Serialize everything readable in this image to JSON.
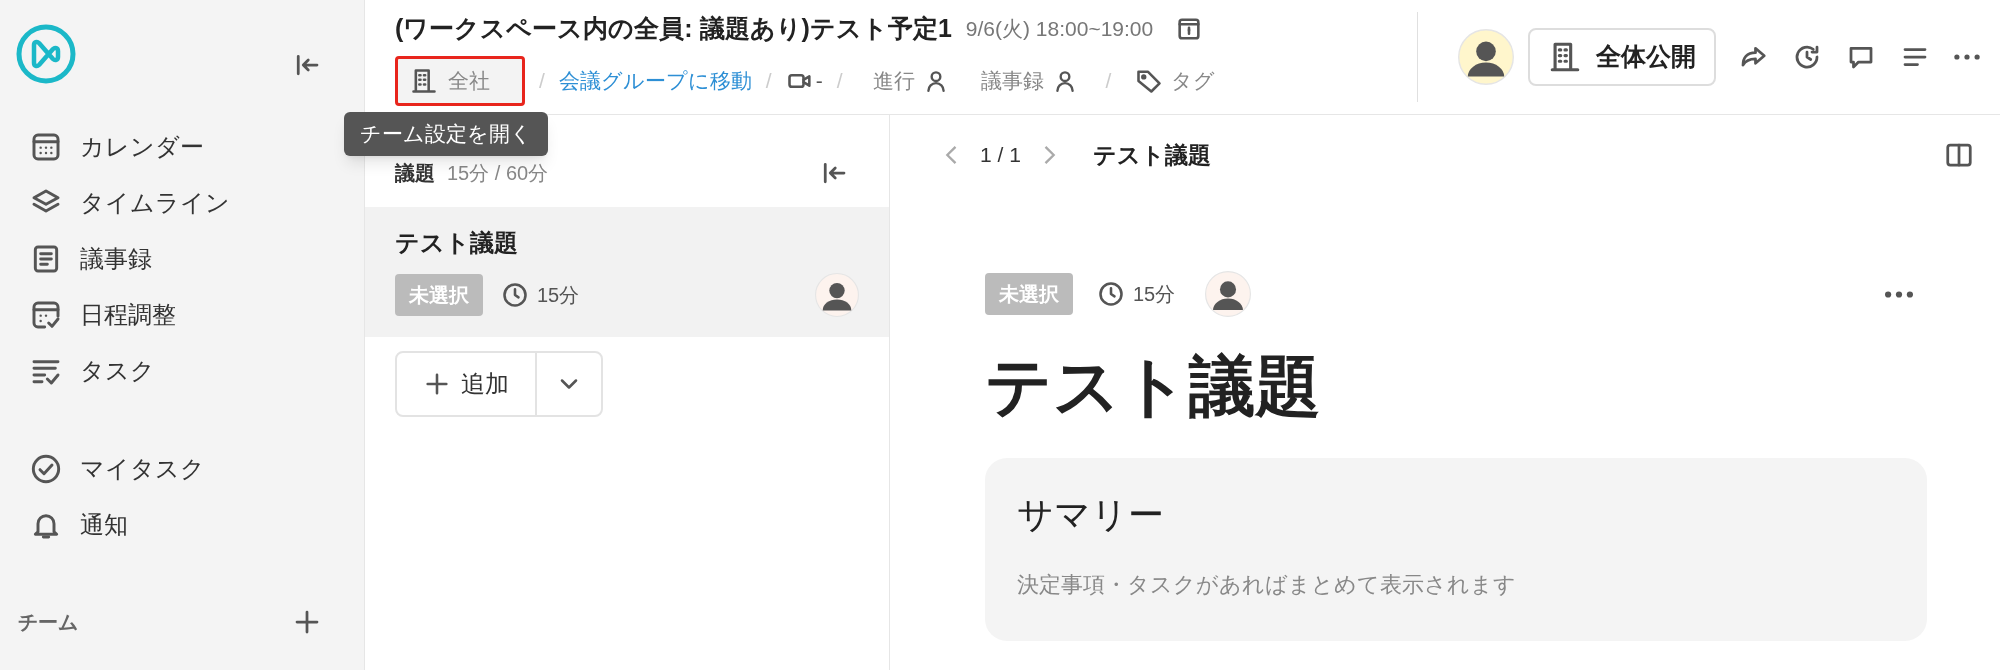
{
  "sidebar": {
    "nav_items": [
      {
        "label": "カレンダー"
      },
      {
        "label": "タイムライン"
      },
      {
        "label": "議事録"
      },
      {
        "label": "日程調整"
      },
      {
        "label": "タスク"
      }
    ],
    "personal_items": [
      {
        "label": "マイタスク"
      },
      {
        "label": "通知"
      }
    ],
    "team_section": {
      "label": "チーム"
    }
  },
  "header": {
    "title": "(ワークスペース内の全員: 議題あり)テスト予定1",
    "datetime": "9/6(火) 18:00~19:00",
    "team_chip": {
      "label": "全社",
      "highlighted": true
    },
    "group_link": "会議グループに移動",
    "video": "-",
    "facilitator": "進行",
    "minutes_taker": "議事録",
    "tags": "タグ",
    "visibility_button": "全体公開",
    "separators": [
      "/",
      "/",
      "/",
      "/"
    ]
  },
  "tooltip": "チーム設定を開く",
  "agenda_panel": {
    "label": "議題",
    "time": "15分 / 60分",
    "items": [
      {
        "title": "テスト議題",
        "status": "未選択",
        "duration": "15分",
        "selected": true
      }
    ],
    "add_button": "追加"
  },
  "detail": {
    "pager": "1 / 1",
    "breadcrumb_title": "テスト議題",
    "status": "未選択",
    "duration": "15分",
    "title": "テスト議題",
    "summary": {
      "title": "サマリー",
      "text": "決定事項・タスクがあればまとめて表示されます"
    }
  }
}
